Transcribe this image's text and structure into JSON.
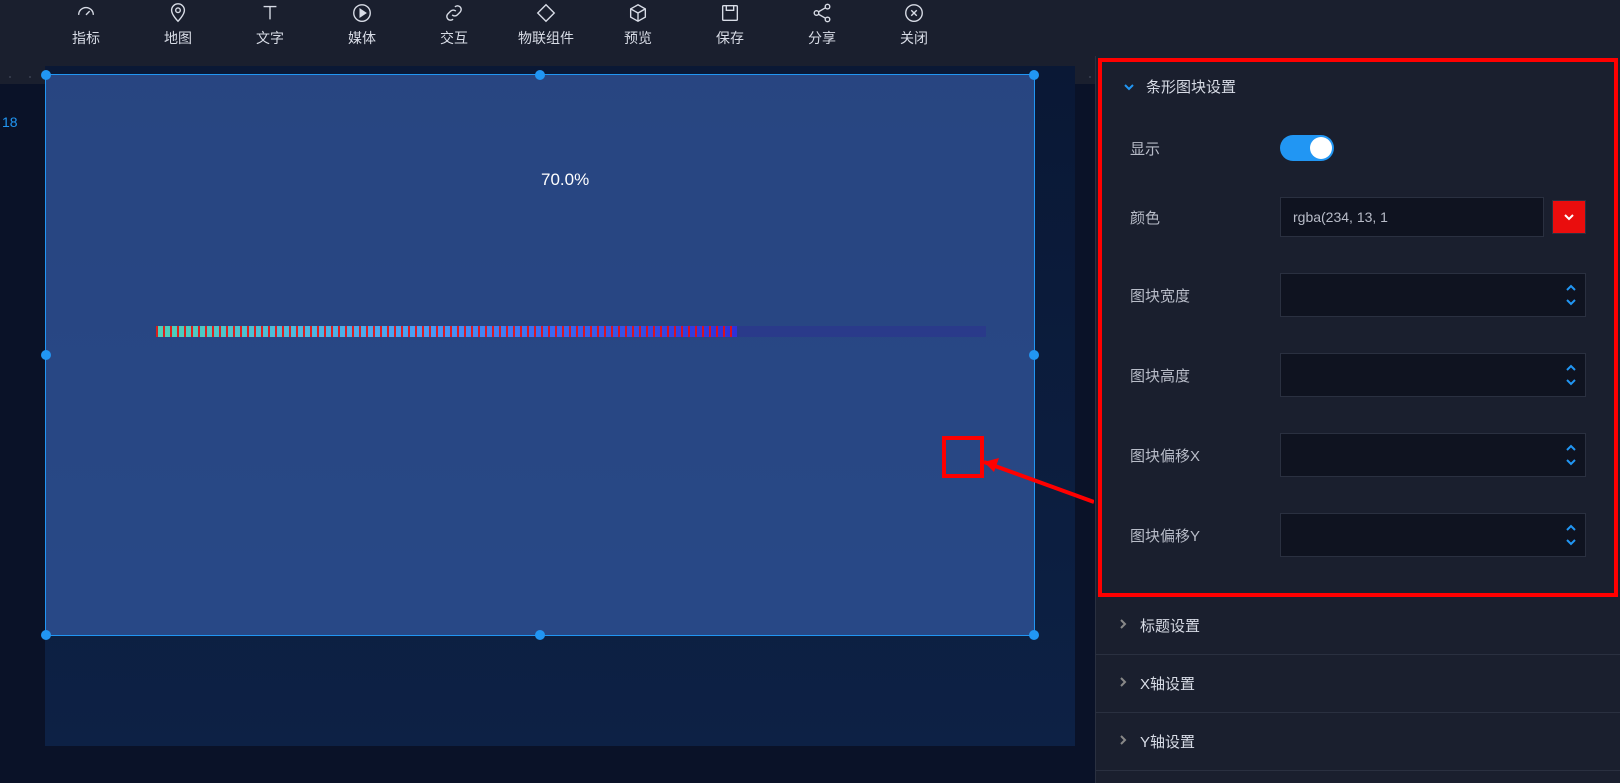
{
  "ruler_mark": "18",
  "toolbar": [
    {
      "label": "指标",
      "icon": "gauge"
    },
    {
      "label": "地图",
      "icon": "map-pin"
    },
    {
      "label": "文字",
      "icon": "text"
    },
    {
      "label": "媒体",
      "icon": "play-circle"
    },
    {
      "label": "交互",
      "icon": "link"
    },
    {
      "label": "物联组件",
      "icon": "diamond"
    },
    {
      "label": "预览",
      "icon": "cube"
    },
    {
      "label": "保存",
      "icon": "save"
    },
    {
      "label": "分享",
      "icon": "share"
    },
    {
      "label": "关闭",
      "icon": "close-circle"
    }
  ],
  "canvas": {
    "progress_text": "70.0%",
    "progress_value": 70.0
  },
  "panel": {
    "section_title": "条形图块设置",
    "display_label": "显示",
    "display_value": true,
    "color_label": "颜色",
    "color_value": "rgba(234, 13, 1",
    "color_hex": "#ea0d0d",
    "block_width_label": "图块宽度",
    "block_width_value": "",
    "block_height_label": "图块高度",
    "block_height_value": "",
    "block_offset_x_label": "图块偏移X",
    "block_offset_x_value": "",
    "block_offset_y_label": "图块偏移Y",
    "block_offset_y_value": "",
    "collapsed_sections": [
      "标题设置",
      "X轴设置",
      "Y轴设置"
    ]
  }
}
